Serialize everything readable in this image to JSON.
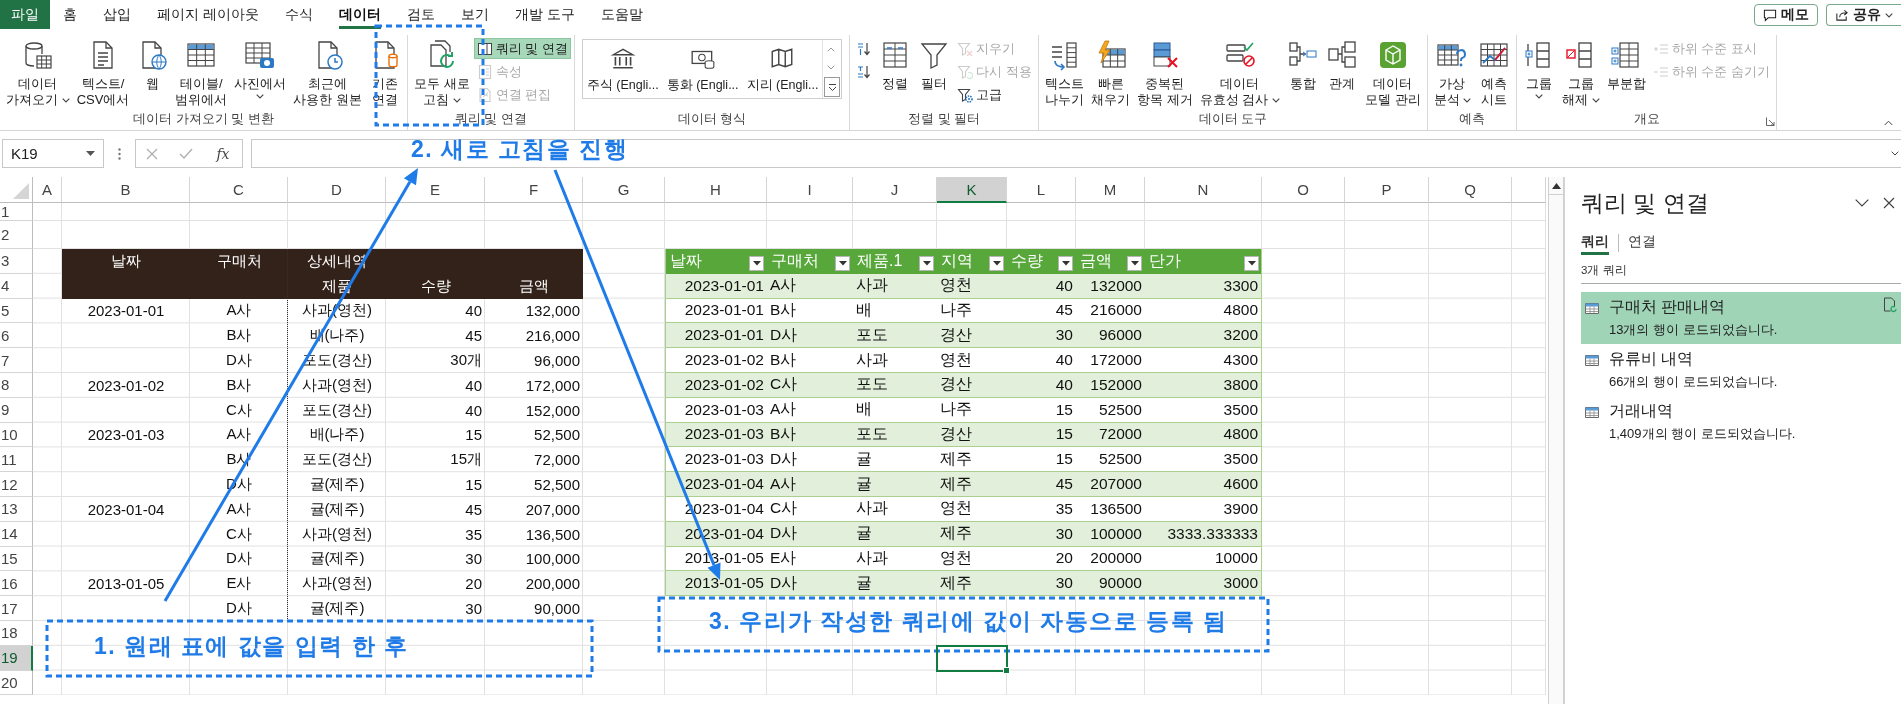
{
  "menu_tabs": [
    {
      "label": "파일",
      "kind": "file",
      "selected": false
    },
    {
      "label": "홈",
      "kind": "tab",
      "selected": false
    },
    {
      "label": "삽입",
      "kind": "tab",
      "selected": false
    },
    {
      "label": "페이지 레이아웃",
      "kind": "tab",
      "selected": false
    },
    {
      "label": "수식",
      "kind": "tab",
      "selected": false
    },
    {
      "label": "데이터",
      "kind": "tab",
      "selected": true
    },
    {
      "label": "검토",
      "kind": "tab",
      "selected": false
    },
    {
      "label": "보기",
      "kind": "tab",
      "selected": false
    },
    {
      "label": "개발 도구",
      "kind": "tab",
      "selected": false
    },
    {
      "label": "도움말",
      "kind": "tab",
      "selected": false
    }
  ],
  "header_buttons": [
    {
      "label": "메모",
      "dropdown": false
    },
    {
      "label": "공유",
      "dropdown": true
    }
  ],
  "ribbon_groups": [
    {
      "label": "데이터 가져오기 및 변환",
      "buttons": [
        {
          "kind": "large",
          "label": "데이터\n가져오기",
          "dropdown": true,
          "disabled": false,
          "on": false
        },
        {
          "kind": "large",
          "label": "텍스트/\nCSV에서",
          "dropdown": false,
          "disabled": false,
          "on": false
        },
        {
          "kind": "large",
          "label": "웹",
          "dropdown": false,
          "disabled": false,
          "on": false
        },
        {
          "kind": "large",
          "label": "테이블/\n범위에서",
          "dropdown": false,
          "disabled": false,
          "on": false
        },
        {
          "kind": "large",
          "label": "사진에서",
          "dropdown": true,
          "disabled": false,
          "on": false
        },
        {
          "kind": "large",
          "label": "최근에\n사용한 원본",
          "dropdown": false,
          "disabled": false,
          "on": false
        },
        {
          "kind": "large",
          "label": "기존\n연결",
          "dropdown": false,
          "disabled": false,
          "on": false
        }
      ]
    },
    {
      "label": "쿼리 및 연결",
      "buttons": [
        {
          "kind": "large",
          "label": "모두 새로\n고침",
          "dropdown": true,
          "disabled": false,
          "on": false
        },
        {
          "kind": "small",
          "label": "쿼리 및 연결",
          "dropdown": false,
          "disabled": false,
          "on": true
        },
        {
          "kind": "small",
          "label": "속성",
          "dropdown": false,
          "disabled": true,
          "on": false
        },
        {
          "kind": "small",
          "label": "연결 편집",
          "dropdown": false,
          "disabled": true,
          "on": false
        }
      ]
    },
    {
      "label": "데이터 형식",
      "buttons": [
        {
          "kind": "gallery",
          "items": [
            {
              "label": "주식 (Engli..."
            },
            {
              "label": "통화 (Engli..."
            },
            {
              "label": "지리 (Engli..."
            }
          ]
        }
      ]
    },
    {
      "label": "정렬 및 필터",
      "buttons": [
        {
          "kind": "icon",
          "dropdown": false,
          "disabled": false,
          "on": false
        },
        {
          "kind": "icon",
          "dropdown": false,
          "disabled": false,
          "on": false
        },
        {
          "kind": "large",
          "label": "정렬",
          "dropdown": false,
          "disabled": false,
          "on": false
        },
        {
          "kind": "large",
          "label": "필터",
          "dropdown": false,
          "disabled": false,
          "on": false
        },
        {
          "kind": "small",
          "label": "지우기",
          "dropdown": false,
          "disabled": true,
          "on": false
        },
        {
          "kind": "small",
          "label": "다시 적용",
          "dropdown": false,
          "disabled": true,
          "on": false
        },
        {
          "kind": "small",
          "label": "고급",
          "dropdown": false,
          "disabled": false,
          "on": false
        }
      ]
    },
    {
      "label": "데이터 도구",
      "buttons": [
        {
          "kind": "large",
          "label": "텍스트\n나누기",
          "dropdown": false,
          "disabled": false,
          "on": false
        },
        {
          "kind": "large",
          "label": "빠른\n채우기",
          "dropdown": false,
          "disabled": false,
          "on": false
        },
        {
          "kind": "large",
          "label": "중복된\n항목 제거",
          "dropdown": false,
          "disabled": false,
          "on": false
        },
        {
          "kind": "large",
          "label": "데이터\n유효성 검사",
          "dropdown": true,
          "disabled": false,
          "on": false
        },
        {
          "kind": "large",
          "label": "통합",
          "dropdown": false,
          "disabled": false,
          "on": false
        },
        {
          "kind": "large",
          "label": "관계",
          "dropdown": false,
          "disabled": false,
          "on": false
        },
        {
          "kind": "large",
          "label": "데이터\n모델 관리",
          "dropdown": false,
          "disabled": false,
          "on": false
        }
      ]
    },
    {
      "label": "예측",
      "buttons": [
        {
          "kind": "large",
          "label": "가상\n분석",
          "dropdown": true,
          "disabled": false,
          "on": false
        },
        {
          "kind": "large",
          "label": "예측\n시트",
          "dropdown": false,
          "disabled": false,
          "on": false
        }
      ]
    },
    {
      "label": "개요",
      "dialog_launcher": true,
      "buttons": [
        {
          "kind": "large",
          "label": "그룹",
          "dropdown": true,
          "disabled": false,
          "on": false
        },
        {
          "kind": "large",
          "label": "그룹\n해제",
          "dropdown": true,
          "disabled": false,
          "on": false
        },
        {
          "kind": "large",
          "label": "부분합",
          "dropdown": false,
          "disabled": false,
          "on": false
        },
        {
          "kind": "small",
          "label": "하위 수준 표시",
          "dropdown": false,
          "disabled": true,
          "on": false
        },
        {
          "kind": "small",
          "label": "하위 수준 숨기기",
          "dropdown": false,
          "disabled": true,
          "on": false
        }
      ]
    }
  ],
  "formula_bar": {
    "name_box": "K19",
    "function_label": "fx"
  },
  "sheet": {
    "columns": [
      {
        "label": "A",
        "selected": false
      },
      {
        "label": "B",
        "selected": false
      },
      {
        "label": "C",
        "selected": false
      },
      {
        "label": "D",
        "selected": false
      },
      {
        "label": "E",
        "selected": false
      },
      {
        "label": "F",
        "selected": false
      },
      {
        "label": "G",
        "selected": false
      },
      {
        "label": "H",
        "selected": false
      },
      {
        "label": "I",
        "selected": false
      },
      {
        "label": "J",
        "selected": false
      },
      {
        "label": "K",
        "selected": true
      },
      {
        "label": "L",
        "selected": false
      },
      {
        "label": "M",
        "selected": false
      },
      {
        "label": "N",
        "selected": false
      },
      {
        "label": "O",
        "selected": false
      },
      {
        "label": "P",
        "selected": false
      },
      {
        "label": "Q",
        "selected": false
      }
    ],
    "rows": [
      {
        "label": "1",
        "selected": false
      },
      {
        "label": "2",
        "selected": false
      },
      {
        "label": "3",
        "selected": false
      },
      {
        "label": "4",
        "selected": false
      },
      {
        "label": "5",
        "selected": false
      },
      {
        "label": "6",
        "selected": false
      },
      {
        "label": "7",
        "selected": false
      },
      {
        "label": "8",
        "selected": false
      },
      {
        "label": "9",
        "selected": false
      },
      {
        "label": "10",
        "selected": false
      },
      {
        "label": "11",
        "selected": false
      },
      {
        "label": "12",
        "selected": false
      },
      {
        "label": "13",
        "selected": false
      },
      {
        "label": "14",
        "selected": false
      },
      {
        "label": "15",
        "selected": false
      },
      {
        "label": "16",
        "selected": false
      },
      {
        "label": "17",
        "selected": false
      },
      {
        "label": "18",
        "selected": false
      },
      {
        "label": "19",
        "selected": true
      },
      {
        "label": "20",
        "selected": false
      }
    ],
    "source_table": {
      "top_headers": [
        "날짜",
        "구매처",
        "상세내역"
      ],
      "sub_headers": [
        "제품",
        "수량",
        "금액"
      ],
      "rows": [
        {
          "date": "2023-01-01",
          "buyer": "A사",
          "product": "사과(영천)",
          "qty": "40",
          "amount": "132,000"
        },
        {
          "buyer": "B사",
          "product": "배(나주)",
          "qty": "45",
          "amount": "216,000"
        },
        {
          "buyer": "D사",
          "product": "포도(경산)",
          "qty": "30개",
          "amount": "96,000"
        },
        {
          "date": "2023-01-02",
          "buyer": "B사",
          "product": "사과(영천)",
          "qty": "40",
          "amount": "172,000"
        },
        {
          "buyer": "C사",
          "product": "포도(경산)",
          "qty": "40",
          "amount": "152,000"
        },
        {
          "date": "2023-01-03",
          "buyer": "A사",
          "product": "배(나주)",
          "qty": "15",
          "amount": "52,500"
        },
        {
          "buyer": "B사",
          "product": "포도(경산)",
          "qty": "15개",
          "amount": "72,000"
        },
        {
          "buyer": "D사",
          "product": "귤(제주)",
          "qty": "15",
          "amount": "52,500"
        },
        {
          "date": "2023-01-04",
          "buyer": "A사",
          "product": "귤(제주)",
          "qty": "45",
          "amount": "207,000"
        },
        {
          "buyer": "C사",
          "product": "사과(영천)",
          "qty": "35",
          "amount": "136,500"
        },
        {
          "buyer": "D사",
          "product": "귤(제주)",
          "qty": "30",
          "amount": "100,000"
        },
        {
          "date": "2013-01-05",
          "buyer": "E사",
          "product": "사과(영천)",
          "qty": "20",
          "amount": "200,000"
        },
        {
          "buyer": "D사",
          "product": "귤(제주)",
          "qty": "30",
          "amount": "90,000"
        }
      ]
    },
    "query_table": {
      "columns": [
        {
          "label": "날짜",
          "kind": "number"
        },
        {
          "label": "구매처",
          "kind": "text"
        },
        {
          "label": "제품.1",
          "kind": "text"
        },
        {
          "label": "지역",
          "kind": "text"
        },
        {
          "label": "수량",
          "kind": "number"
        },
        {
          "label": "금액",
          "kind": "number"
        },
        {
          "label": "단가",
          "kind": "number"
        }
      ],
      "rows": [
        [
          "2023-01-01",
          "A사",
          "사과",
          "영천",
          "40",
          "132000",
          "3300"
        ],
        [
          "2023-01-01",
          "B사",
          "배",
          "나주",
          "45",
          "216000",
          "4800"
        ],
        [
          "2023-01-01",
          "D사",
          "포도",
          "경산",
          "30",
          "96000",
          "3200"
        ],
        [
          "2023-01-02",
          "B사",
          "사과",
          "영천",
          "40",
          "172000",
          "4300"
        ],
        [
          "2023-01-02",
          "C사",
          "포도",
          "경산",
          "40",
          "152000",
          "3800"
        ],
        [
          "2023-01-03",
          "A사",
          "배",
          "나주",
          "15",
          "52500",
          "3500"
        ],
        [
          "2023-01-03",
          "B사",
          "포도",
          "경산",
          "15",
          "72000",
          "4800"
        ],
        [
          "2023-01-03",
          "D사",
          "귤",
          "제주",
          "15",
          "52500",
          "3500"
        ],
        [
          "2023-01-04",
          "A사",
          "귤",
          "제주",
          "45",
          "207000",
          "4600"
        ],
        [
          "2023-01-04",
          "C사",
          "사과",
          "영천",
          "35",
          "136500",
          "3900"
        ],
        [
          "2023-01-04",
          "D사",
          "귤",
          "제주",
          "30",
          "100000",
          "3333.333333"
        ],
        [
          "2013-01-05",
          "E사",
          "사과",
          "영천",
          "20",
          "200000",
          "10000"
        ],
        [
          "2013-01-05",
          "D사",
          "귤",
          "제주",
          "30",
          "90000",
          "3000"
        ]
      ]
    }
  },
  "query_pane": {
    "title": "쿼리 및 연결",
    "tabs": [
      {
        "label": "쿼리",
        "selected": true
      },
      {
        "label": "연결",
        "selected": false
      }
    ],
    "count": "3개 쿼리",
    "queries": [
      {
        "name": "구매처 판매내역",
        "status": "13개의 행이 로드되었습니다.",
        "selected": true
      },
      {
        "name": "유류비 내역",
        "status": "66개의 행이 로드되었습니다.",
        "selected": false
      },
      {
        "name": "거래내역",
        "status": "1,409개의 행이 로드되었습니다.",
        "selected": false
      }
    ]
  },
  "annotations": [
    {
      "text": "1. 원래 표에 값을 입력 한 후"
    },
    {
      "text": "2. 새로 고침을 진행"
    },
    {
      "text": "3. 우리가 작성한 쿼리에 값이 자동으로 등록 됨"
    }
  ]
}
